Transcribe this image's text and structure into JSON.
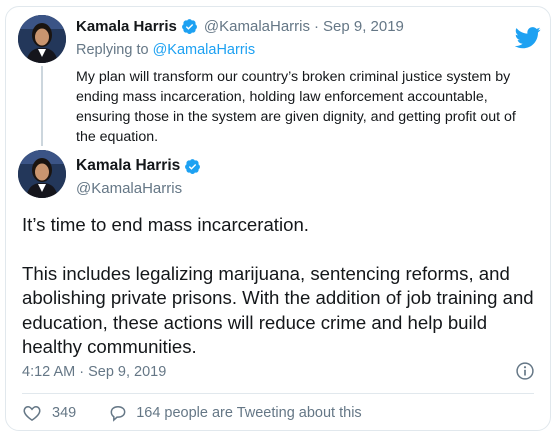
{
  "quoted_tweet": {
    "author_name": "Kamala Harris",
    "handle": "@KamalaHarris",
    "separator": "·",
    "date": "Sep 9, 2019",
    "replying_prefix": "Replying to",
    "replying_to": "@KamalaHarris",
    "text": "My plan will transform our country’s broken criminal justice system by ending mass incarceration, holding law enforcement accountable, ensuring those in the system are given dignity, and getting profit out of the equation."
  },
  "main_tweet": {
    "author_name": "Kamala Harris",
    "handle": "@KamalaHarris",
    "paragraphs": [
      "It’s time to end mass incarceration.",
      "This includes legalizing marijuana, sentencing reforms, and abolishing private prisons. With the addition of job training and education, these actions will reduce crime and help build healthy communities."
    ],
    "timestamp": "4:12 AM · Sep 9, 2019"
  },
  "actions": {
    "like_count": "349",
    "people_tweeting": "164 people are Tweeting about this"
  },
  "icons": {
    "verified": "verified-badge-icon",
    "logo": "twitter-bird-icon",
    "info": "info-icon",
    "like": "heart-icon",
    "reply": "speech-bubble-icon"
  },
  "colors": {
    "brand_blue": "#1da1f2",
    "secondary_text": "#657786",
    "border": "#e1e8ed"
  }
}
